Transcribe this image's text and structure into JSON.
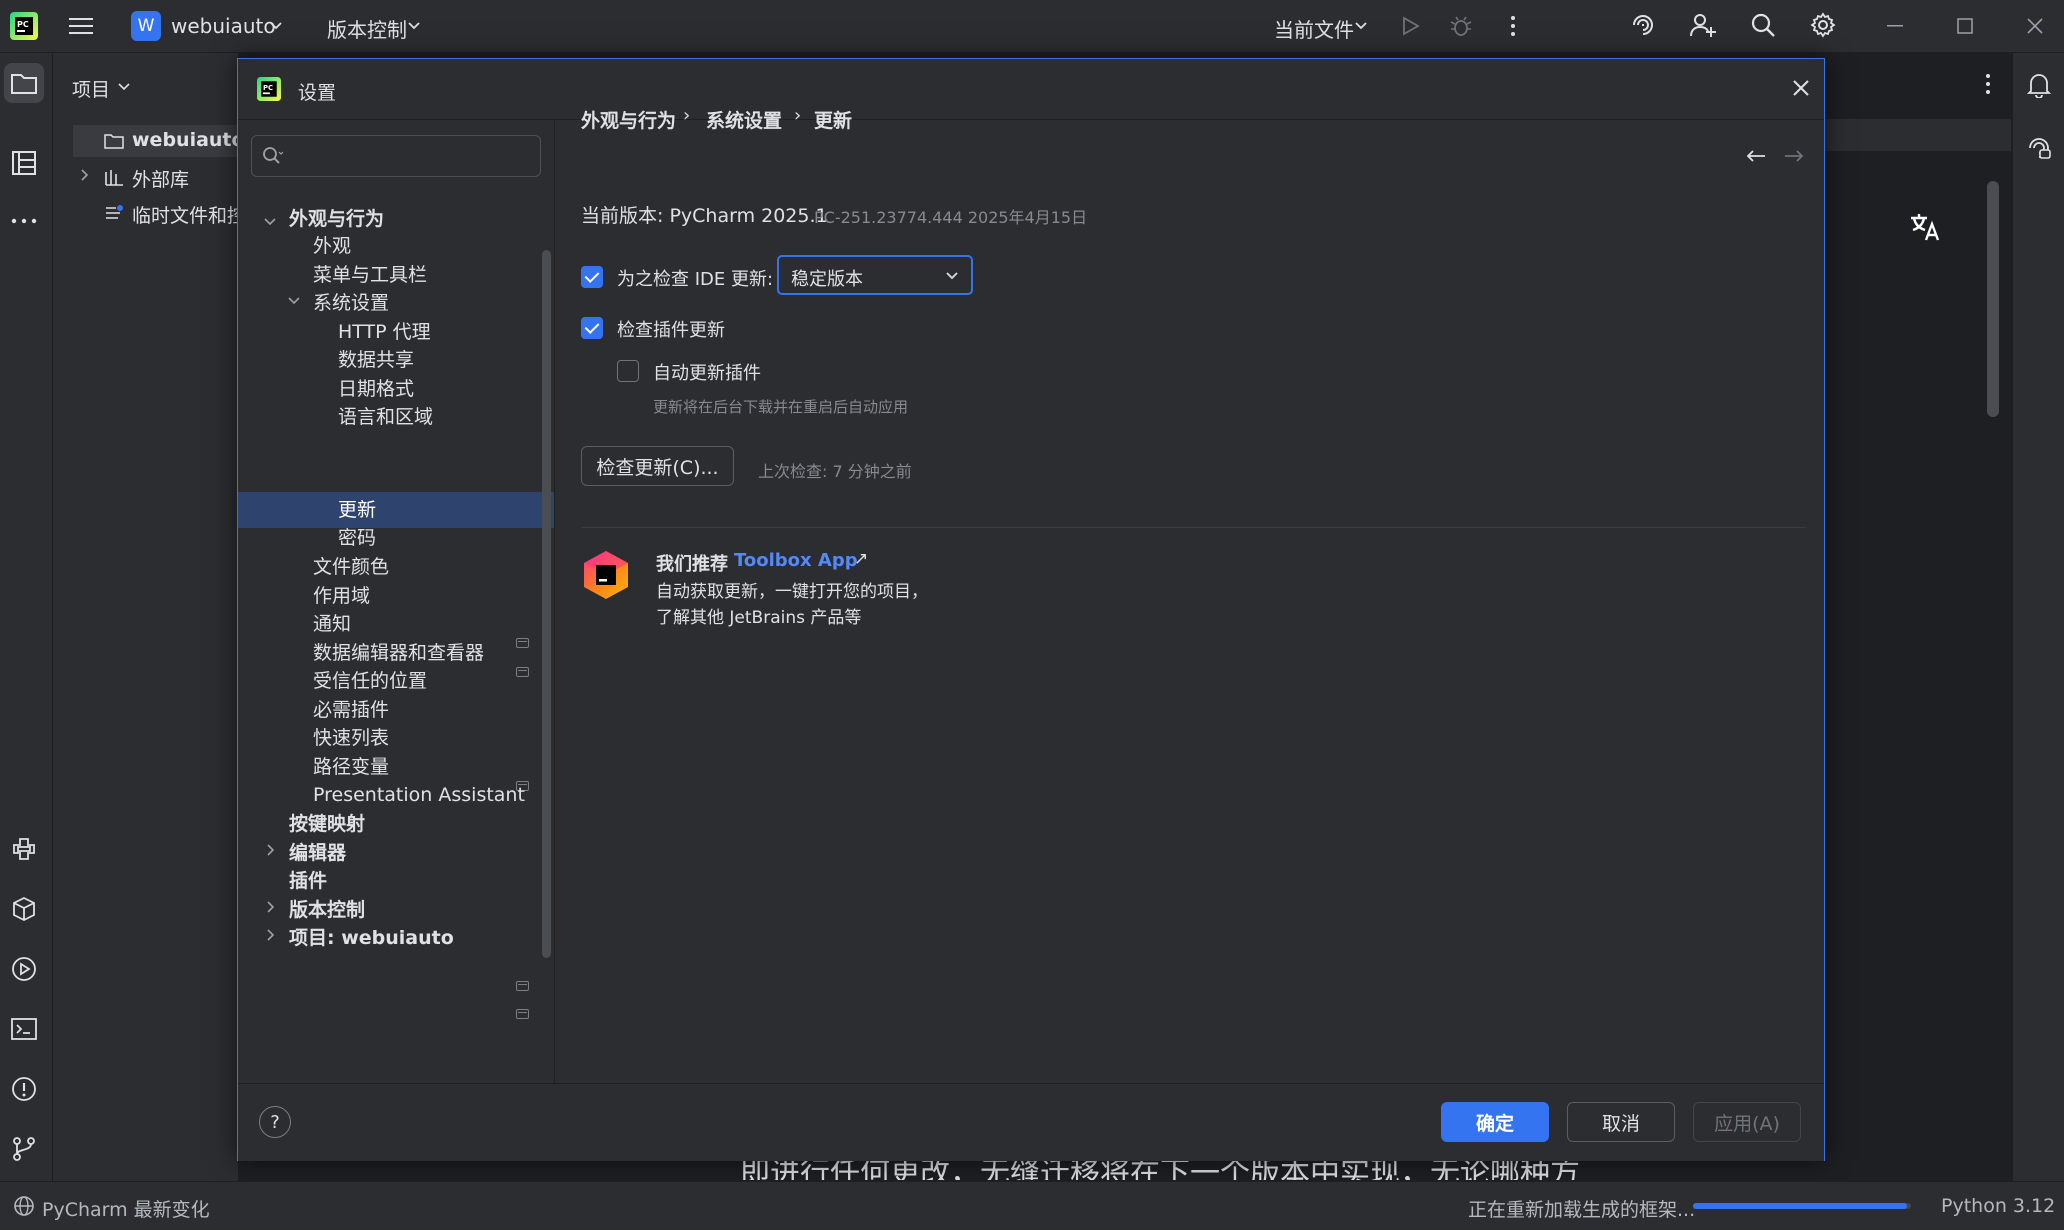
{
  "titlebar": {
    "project_badge": "W",
    "project_name": "webuiauto",
    "vcs_menu": "版本控制",
    "run_config": "当前文件"
  },
  "project_panel": {
    "title": "项目",
    "items": [
      {
        "label": "webuiauto"
      },
      {
        "label": "外部库"
      },
      {
        "label": "临时文件和控"
      }
    ]
  },
  "dialog": {
    "title": "设置",
    "search": {
      "placeholder": ""
    },
    "tree": [
      {
        "label": "外观与行为",
        "bold": true
      },
      {
        "label": "外观"
      },
      {
        "label": "菜单与工具栏"
      },
      {
        "label": "系统设置"
      },
      {
        "label": "HTTP 代理"
      },
      {
        "label": "数据共享"
      },
      {
        "label": "日期格式"
      },
      {
        "label": "语言和区域"
      },
      {
        "label": "更新"
      },
      {
        "label": "密码"
      },
      {
        "label": "文件颜色"
      },
      {
        "label": "作用域"
      },
      {
        "label": "通知"
      },
      {
        "label": "数据编辑器和查看器"
      },
      {
        "label": "受信任的位置"
      },
      {
        "label": "必需插件"
      },
      {
        "label": "快速列表"
      },
      {
        "label": "路径变量"
      },
      {
        "label": "Presentation Assistant"
      },
      {
        "label": "按键映射",
        "bold": true
      },
      {
        "label": "编辑器",
        "bold": true
      },
      {
        "label": "插件",
        "bold": true
      },
      {
        "label": "版本控制",
        "bold": true
      },
      {
        "label": "项目: webuiauto",
        "bold": true
      }
    ],
    "breadcrumb": [
      "外观与行为",
      "系统设置",
      "更新"
    ],
    "version_label": "当前版本: PyCharm 2025.1",
    "version_detail": "PC-251.23774.444 2025年4月15日",
    "check_ide_label": "为之检查 IDE 更新:",
    "check_ide_checked": true,
    "channel_value": "稳定版本",
    "check_plugins_label": "检查插件更新",
    "check_plugins_checked": true,
    "auto_update_label": "自动更新插件",
    "auto_update_checked": false,
    "auto_update_hint": "更新将在后台下载并在重启后自动应用",
    "check_button": "检查更新(C)...",
    "last_check": "上次检查: 7 分钟之前",
    "toolbox": {
      "prefix": "我们推荐 ",
      "link": "Toolbox App",
      "arrow": "↗",
      "line1": "自动获取更新，一键打开您的项目，",
      "line2": "了解其他 JetBrains 产品等"
    },
    "footer": {
      "help": "?",
      "ok": "确定",
      "cancel": "取消",
      "apply": "应用(A)"
    }
  },
  "editor_bg_text": "即进行任何更改，无缝迁移将在下一个版本中实现，无论哪种方",
  "statusbar": {
    "whats_new": "PyCharm 最新变化",
    "progress_text": "正在重新加载生成的框架...",
    "progress": 0.98,
    "interpreter": "Python 3.12"
  },
  "colors": {
    "accent": "#3574f0",
    "selection": "#2e436e",
    "background": "#2b2d30"
  }
}
